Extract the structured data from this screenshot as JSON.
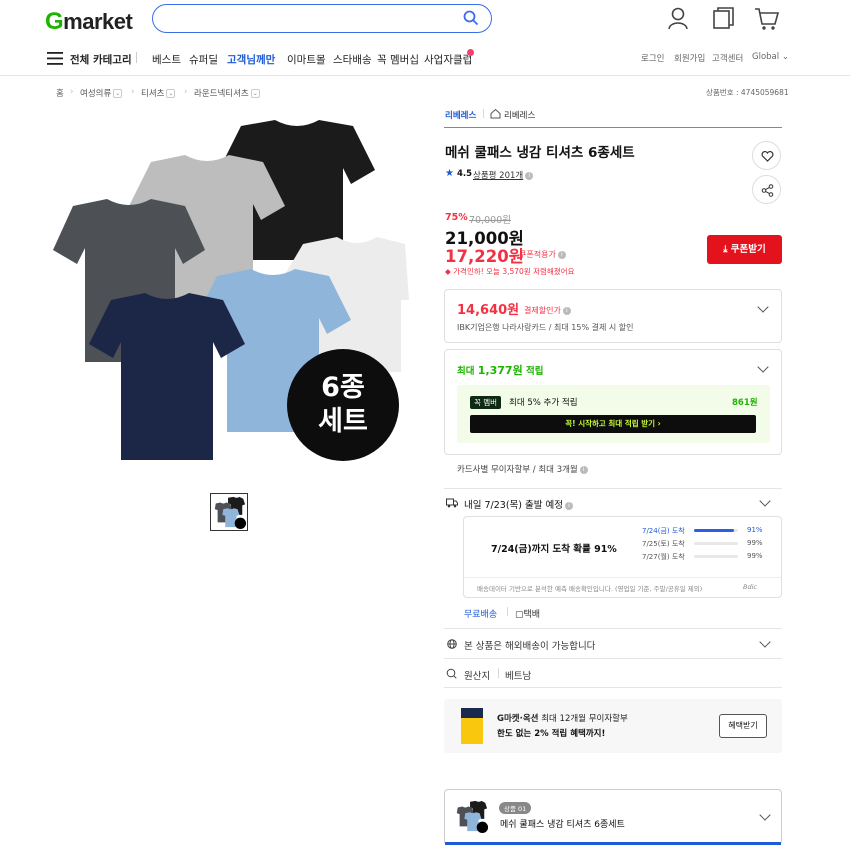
{
  "header": {
    "logo_g": "G",
    "logo_rest": "market",
    "search_value": ""
  },
  "nav": {
    "all_categories": "전체 카테고리",
    "items": [
      "베스트",
      "슈퍼딜",
      "고객님께만",
      "이마트몰",
      "스타배송",
      "꼭 멤버십",
      "사업자클럽"
    ],
    "highlight_color": "#1e5bd6",
    "util": [
      "로그인",
      "회원가입",
      "고객센터",
      "Global"
    ]
  },
  "breadcrumb": {
    "items": [
      "홈",
      "여성의류",
      "티셔츠",
      "라운드넥티셔츠"
    ],
    "product_no": "상품번호 : 4745059681"
  },
  "image": {
    "badge_line1": "6종",
    "badge_line2": "세트"
  },
  "seller": {
    "name": "리베레스",
    "store": "리베레스"
  },
  "product": {
    "title": "메쉬 쿨패스 냉감 티셔츠 6종세트",
    "rating": "4.5",
    "reviews": "상품평 201개",
    "discount": "75%",
    "original_price": "70,000원",
    "sale_price": "21,000원",
    "coupon_price": "17,220원",
    "coupon_label": "쿠폰적용가",
    "savings_note": "가격인하! 오늘 3,570원 저렴해졌어요",
    "coupon_button": "쿠폰받기"
  },
  "card_discount": {
    "price": "14,640원",
    "label": "결제할인가",
    "desc": "IBK기업은행 나라사랑카드 / 최대 15% 결제 시 할인"
  },
  "points": {
    "title_prefix": "최대",
    "amount": "1,377원",
    "title_suffix": "적립",
    "member_badge": "꼭 멤버",
    "member_text": "최대 5% 추가 적립",
    "member_amount": "861원",
    "cta": "꼭! 시작하고 최대 적립 받기",
    "installment": "카드사별 무이자할부 / 최대 3개월"
  },
  "delivery": {
    "title": "내일 7/23(목) 출발 예정",
    "headline": "7/24(금)까지 도착 확률 91%",
    "rows": [
      {
        "date": "7/24(금) 도착",
        "pct": "91%",
        "value": 91
      },
      {
        "date": "7/25(토) 도착",
        "pct": "99%",
        "value": 99
      },
      {
        "date": "7/27(월) 도착",
        "pct": "99%",
        "value": 99
      }
    ],
    "note": "배송데이터 기반으로 분석한 예측 배송확인입니다. (영업일 기준, 주말/공휴일 제외)",
    "brand": "Bdic",
    "free_shipping": "무료배송",
    "courier": "택배"
  },
  "overseas": "본 상품은 해외배송이 가능합니다",
  "origin": {
    "label": "원산지",
    "value": "베트남"
  },
  "promo": {
    "line1_bold": "G마켓·옥션",
    "line1_rest": "최대 12개월 무이자할부",
    "line2": "한도 없는 2% 적립 혜택까지!",
    "button": "혜택받기"
  },
  "option": {
    "badge": "상품 01",
    "name": "메쉬 쿨패스 냉감 티셔츠 6종세트"
  }
}
